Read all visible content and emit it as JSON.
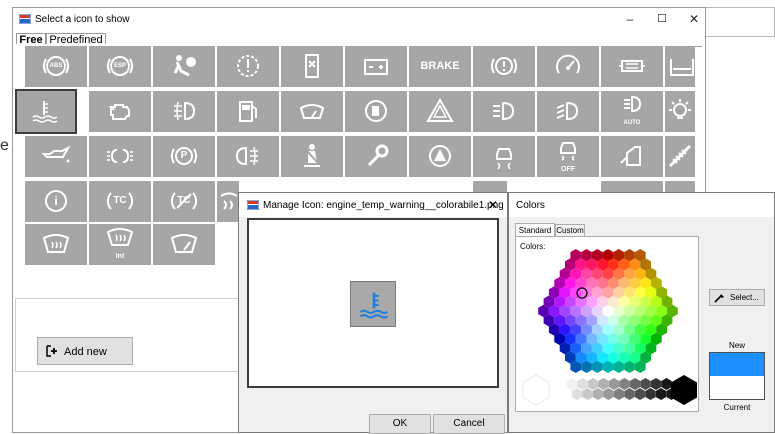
{
  "main_window": {
    "title": "Select a icon to show",
    "tabs": [
      {
        "label": "Free",
        "active": true
      },
      {
        "label": "Predefined",
        "active": false
      }
    ],
    "icons": [
      {
        "name": "abs-warning",
        "text": "ABS"
      },
      {
        "name": "esp-warning",
        "text": "ESP"
      },
      {
        "name": "airbag-warning",
        "text": ""
      },
      {
        "name": "brake-system-warning",
        "text": ""
      },
      {
        "name": "fuel-filter-warning",
        "text": ""
      },
      {
        "name": "battery-warning",
        "text": ""
      },
      {
        "name": "brake-text-warning",
        "text": "BRAKE"
      },
      {
        "name": "brake-circle-warning",
        "text": ""
      },
      {
        "name": "speedometer-warning",
        "text": ""
      },
      {
        "name": "ecu-warning",
        "text": ""
      },
      {
        "name": "coolant-level-warning",
        "text": ""
      },
      {
        "name": "engine-temp-warning",
        "text": ""
      },
      {
        "name": "engine-check-warning",
        "text": ""
      },
      {
        "name": "fog-light-front",
        "text": ""
      },
      {
        "name": "fuel-pump",
        "text": ""
      },
      {
        "name": "washer-fluid",
        "text": ""
      },
      {
        "name": "fuel-cap",
        "text": ""
      },
      {
        "name": "hazard-warning",
        "text": ""
      },
      {
        "name": "low-beam",
        "text": ""
      },
      {
        "name": "auto-high-beam",
        "text": ""
      },
      {
        "name": "auto-headlight",
        "text": "AUTO"
      },
      {
        "name": "bulb-failure",
        "text": ""
      },
      {
        "name": "oil-pressure",
        "text": ""
      },
      {
        "name": "parking-lights",
        "text": ""
      },
      {
        "name": "parking-brake",
        "text": "P"
      },
      {
        "name": "rear-fog-light",
        "text": ""
      },
      {
        "name": "seatbelt-warning",
        "text": ""
      },
      {
        "name": "service-wrench",
        "text": ""
      },
      {
        "name": "master-warning",
        "text": ""
      },
      {
        "name": "traction-control",
        "text": ""
      },
      {
        "name": "traction-control-off",
        "text": "OFF"
      },
      {
        "name": "door-open",
        "text": ""
      },
      {
        "name": "suspension-warning",
        "text": ""
      },
      {
        "name": "information",
        "text": "i"
      },
      {
        "name": "tc-indicator",
        "text": "TC"
      },
      {
        "name": "tc-off-indicator",
        "text": "TC"
      },
      {
        "name": "defrost-partial",
        "text": ""
      },
      {
        "name": "windshield-defrost",
        "text": ""
      },
      {
        "name": "windshield-defrost-int",
        "text": "Int"
      },
      {
        "name": "windshield-wiper",
        "text": ""
      }
    ],
    "add_new_label": "Add new",
    "window_buttons": {
      "minimize": "–",
      "maximize": "☐",
      "close": "✕"
    }
  },
  "manage_dialog": {
    "title": "Manage Icon: engine_temp_warning__colorabile1.png",
    "close": "✕",
    "ok_label": "OK",
    "cancel_label": "Cancel"
  },
  "colors_dialog": {
    "title": "Colors",
    "tabs": [
      {
        "label": "Standard",
        "active": true
      },
      {
        "label": "Custom",
        "active": false
      }
    ],
    "colors_label": "Colors:",
    "select_label": "Select...",
    "new_label": "New",
    "current_label": "Current",
    "new_color": "#1e90ff",
    "current_color": "#ffffff"
  },
  "side_fragment": {
    "letter": "e"
  }
}
